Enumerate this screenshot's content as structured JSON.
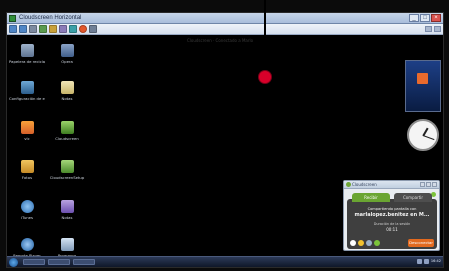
{
  "window": {
    "title": "Cloudscreen Horizontal",
    "buttons": [
      "_",
      "□",
      "×"
    ]
  },
  "toolbar": {
    "icons": [
      "back-icon",
      "forward-icon",
      "cut-icon",
      "copy-icon",
      "paste-icon",
      "settings-icon",
      "image-icon",
      "record-icon",
      "grid-icon"
    ]
  },
  "desktop": {
    "caption": "Cloudscreen · Conectado a Marlo",
    "icons": [
      {
        "name": "recycle-bin",
        "label": "Papelera de reciclaje"
      },
      {
        "name": "opera",
        "label": "Opera"
      },
      {
        "name": "control-panel",
        "label": "Configuración de equipo"
      },
      {
        "name": "notes",
        "label": "Notas"
      },
      {
        "name": "vlc",
        "label": "vlc"
      },
      {
        "name": "cloudscreen",
        "label": "Cloudscreen"
      },
      {
        "name": "folder",
        "label": "Fotos"
      },
      {
        "name": "cloudscreen-setup",
        "label": "CloudscreenSetup"
      },
      {
        "name": "player",
        "label": "iTunes"
      },
      {
        "name": "calendar",
        "label": "Notas"
      },
      {
        "name": "remote-player",
        "label": "Remote Player"
      },
      {
        "name": "program",
        "label": "Programa"
      }
    ]
  },
  "chat": {
    "title": "Cloudscreen",
    "tabs": [
      "Recibir",
      "Compartir"
    ],
    "line1": "Compartiendo pantalla con",
    "line2": "marlalopez.benitez en M...",
    "line3": "Duración de la sesión",
    "line4": "00:11",
    "hangup": "Desconectar"
  },
  "taskbar": {
    "time": "16:42"
  },
  "colors": {
    "chat_accent": "#6aa532",
    "hangup": "#e36a1f",
    "marker": "#d8002a"
  }
}
